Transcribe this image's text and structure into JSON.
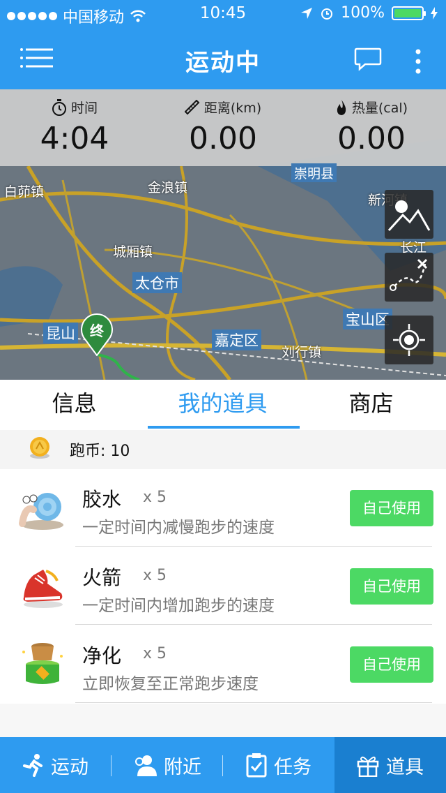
{
  "status_bar": {
    "carrier": "中国移动",
    "time": "10:45",
    "battery": "100%"
  },
  "nav": {
    "title": "运动中",
    "menu_icon": "menu-icon",
    "chat_icon": "chat-bubble-icon",
    "more_icon": "more-vertical-icon"
  },
  "stats": {
    "time": {
      "label": "时间",
      "value": "4:04",
      "icon": "stopwatch-icon"
    },
    "distance": {
      "label": "距离(km)",
      "value": "0.00",
      "icon": "ruler-icon"
    },
    "calories": {
      "label": "热量(cal)",
      "value": "0.00",
      "icon": "flame-icon"
    }
  },
  "map": {
    "labels": [
      "崇明县",
      "白茆镇",
      "金浪镇",
      "新河镇",
      "长江",
      "城厢镇",
      "太仓市",
      "昆山",
      "宝山区",
      "嘉定区",
      "刘行镇"
    ],
    "pin_label": "终"
  },
  "tabs": [
    {
      "label": "信息",
      "active": false
    },
    {
      "label": "我的道具",
      "active": true
    },
    {
      "label": "商店",
      "active": false
    }
  ],
  "coins": {
    "label": "跑币: 10"
  },
  "items": [
    {
      "name": "胶水",
      "qty": "x 5",
      "desc": "一定时间内减慢跑步的速度",
      "button": "自己使用",
      "icon": "snail-icon"
    },
    {
      "name": "火箭",
      "qty": "x 5",
      "desc": "一定时间内增加跑步的速度",
      "button": "自己使用",
      "icon": "sneaker-icon"
    },
    {
      "name": "净化",
      "qty": "x 5",
      "desc": "立即恢复至正常跑步速度",
      "button": "自己使用",
      "icon": "purify-icon"
    }
  ],
  "bottom_tabs": [
    {
      "label": "运动",
      "icon": "running-icon",
      "active": false
    },
    {
      "label": "附近",
      "icon": "people-icon",
      "active": false
    },
    {
      "label": "任务",
      "icon": "clipboard-icon",
      "active": false
    },
    {
      "label": "道具",
      "icon": "gift-icon",
      "active": true
    }
  ],
  "colors": {
    "primary": "#2e9bf0",
    "button_green": "#4cd964",
    "active_tab_bg": "#1a7fd0"
  }
}
